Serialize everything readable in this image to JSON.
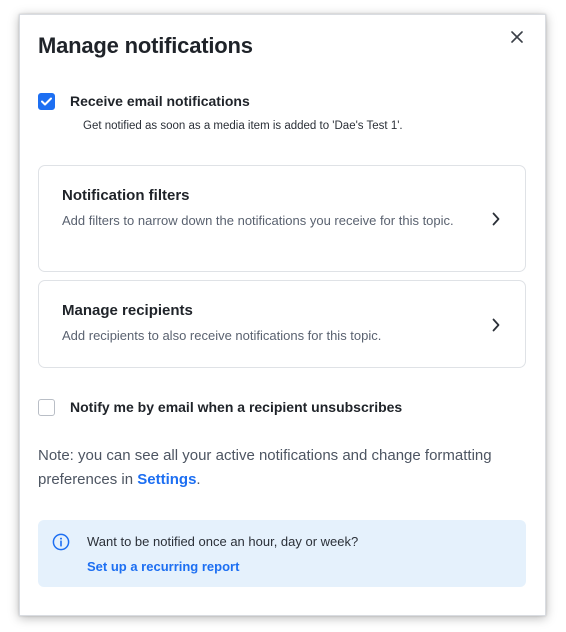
{
  "dialog": {
    "title": "Manage notifications",
    "close_icon": "close-icon"
  },
  "email_notifications": {
    "checked": true,
    "label": "Receive email notifications",
    "description": "Get notified as soon as a media item is added to 'Dae's Test 1'."
  },
  "cards": [
    {
      "title": "Notification filters",
      "description": "Add filters to narrow down the notifications you receive for this topic.",
      "icon": "chevron-right-icon"
    },
    {
      "title": "Manage recipients",
      "description": "Add recipients to also receive notifications for this topic.",
      "icon": "chevron-right-icon"
    }
  ],
  "unsubscribe_notify": {
    "checked": false,
    "label": "Notify me by email when a recipient unsubscribes"
  },
  "note": {
    "text_before": "Note: you can see all your active notifications and change formatting preferences in ",
    "link": "Settings",
    "text_after": "."
  },
  "banner": {
    "icon": "info-icon",
    "message": "Want to be notified once an hour, day or week?",
    "link": "Set up a recurring report"
  },
  "colors": {
    "accent": "#1d6ff2",
    "banner_bg": "#e5f1fc"
  }
}
